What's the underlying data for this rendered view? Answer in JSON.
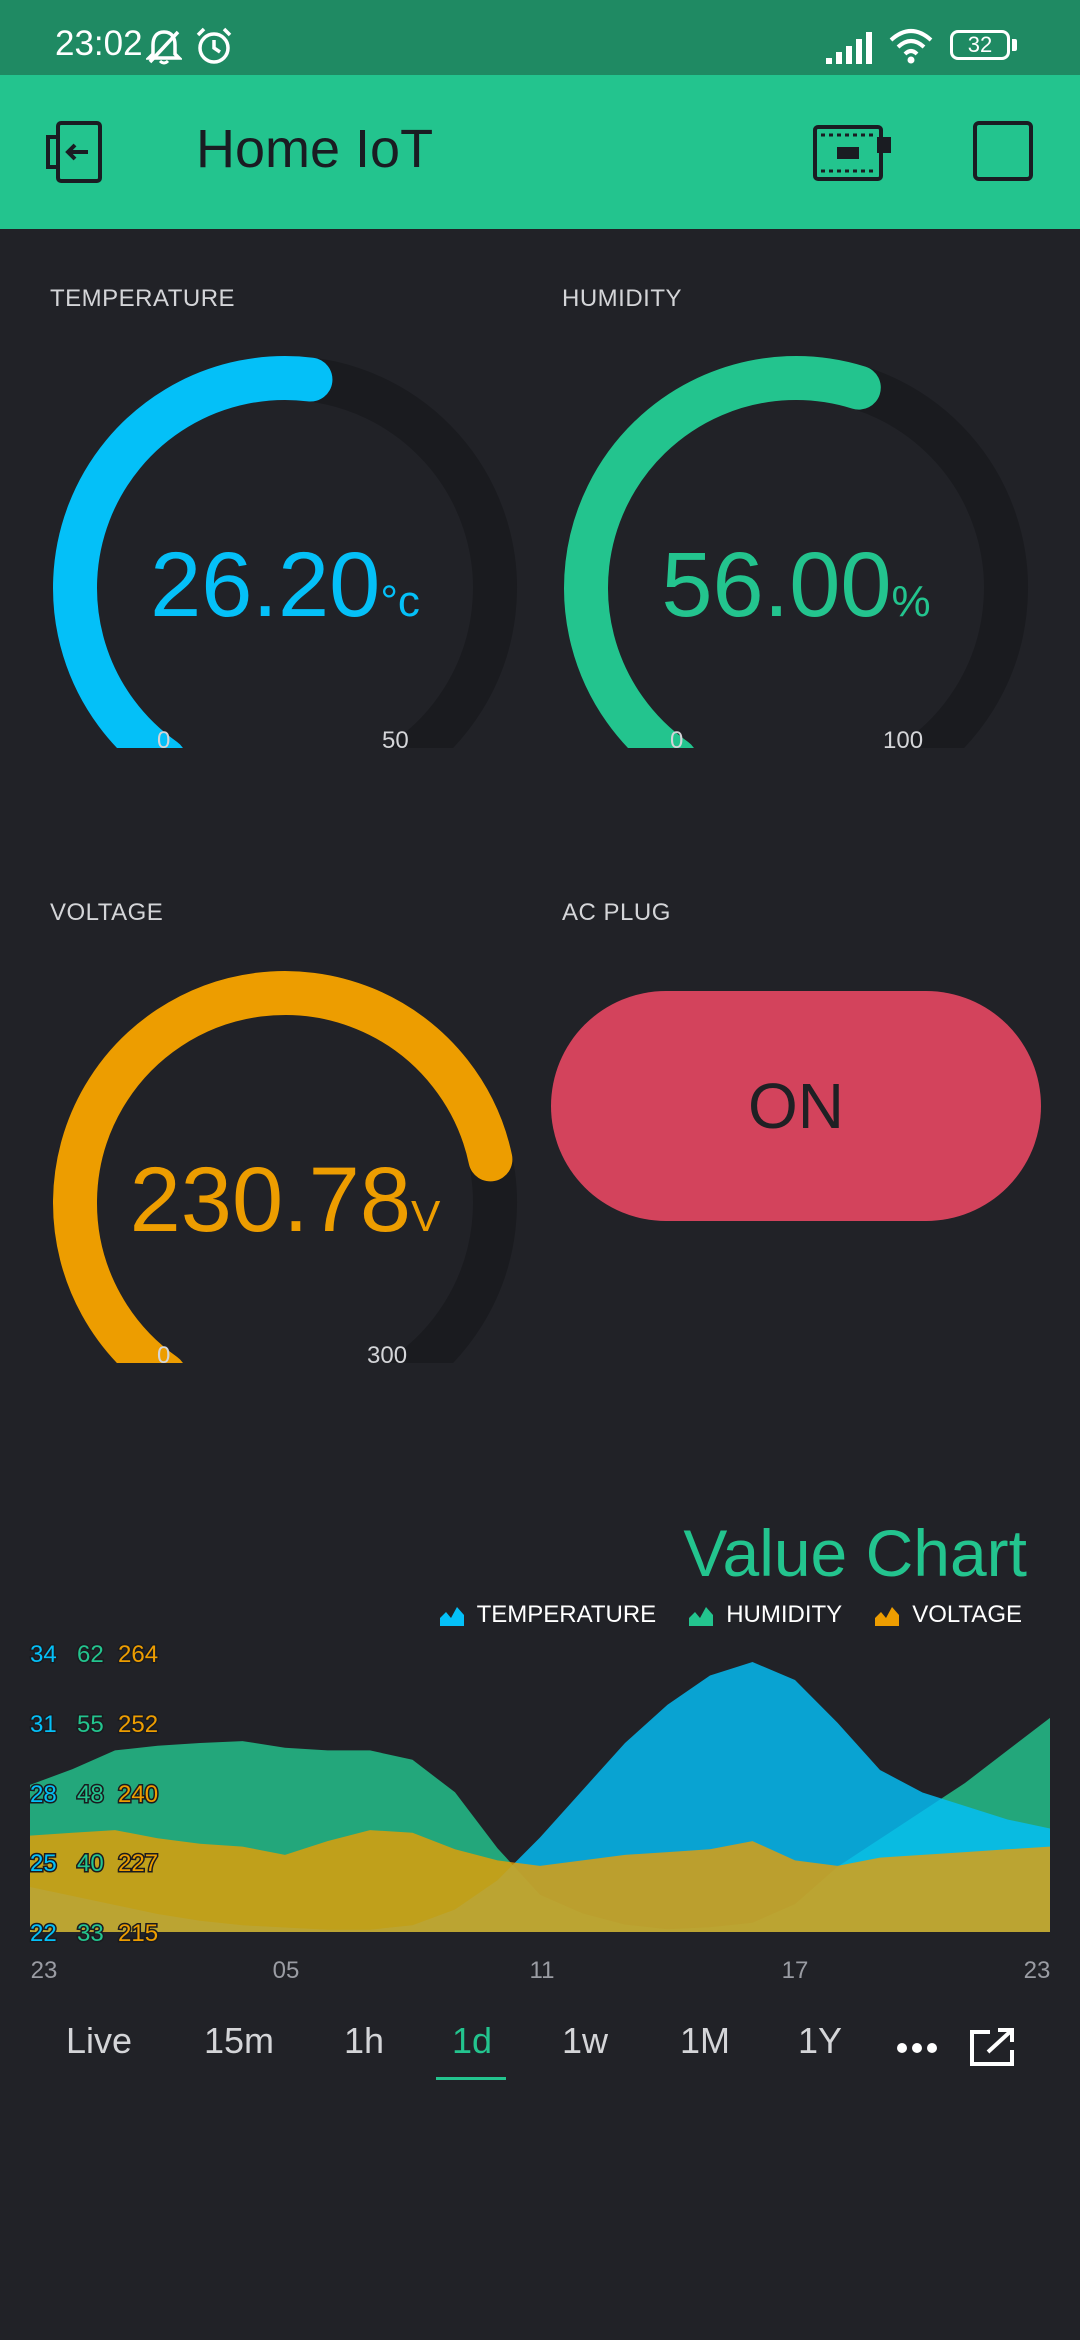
{
  "status_bar": {
    "time": "23:02",
    "battery": "32",
    "icons": [
      "bell-off-icon",
      "alarm-icon",
      "signal-icon",
      "wifi-icon",
      "battery-icon"
    ]
  },
  "app_bar": {
    "title": "Home IoT",
    "icons": [
      "back-icon",
      "device-icon",
      "stop-icon"
    ]
  },
  "colors": {
    "temperature": "#04c0f8",
    "humidity": "#23c48e",
    "voltage": "#ed9d00",
    "plug": "#d3435c",
    "accent": "#23c48e"
  },
  "gauges": {
    "temperature": {
      "label": "TEMPERATURE",
      "value": "26.20",
      "unit": "°c",
      "min": "0",
      "max": "50",
      "fraction": 0.524
    },
    "humidity": {
      "label": "HUMIDITY",
      "value": "56.00",
      "unit": "%",
      "min": "0",
      "max": "100",
      "fraction": 0.56
    },
    "voltage": {
      "label": "VOLTAGE",
      "value": "230.78",
      "unit": "V",
      "min": "0",
      "max": "300",
      "fraction": 0.769
    }
  },
  "plug": {
    "label": "AC PLUG",
    "state": "ON"
  },
  "chart": {
    "title": "Value Chart",
    "legend": [
      "TEMPERATURE",
      "HUMIDITY",
      "VOLTAGE"
    ],
    "y_ticks": {
      "temperature": [
        "34",
        "31",
        "28",
        "25",
        "22"
      ],
      "humidity": [
        "62",
        "55",
        "48",
        "40",
        "33"
      ],
      "voltage": [
        "264",
        "252",
        "240",
        "227",
        "215"
      ]
    },
    "x_ticks": [
      "23",
      "05",
      "11",
      "17",
      "23"
    ]
  },
  "chart_data": {
    "type": "area",
    "title": "Value Chart",
    "x": [
      "23",
      "00",
      "01",
      "02",
      "03",
      "04",
      "05",
      "06",
      "07",
      "08",
      "09",
      "10",
      "11",
      "12",
      "13",
      "14",
      "15",
      "16",
      "17",
      "18",
      "19",
      "20",
      "21",
      "22",
      "23"
    ],
    "series": [
      {
        "name": "TEMPERATURE",
        "values": [
          24.0,
          23.6,
          23.2,
          22.8,
          22.5,
          22.3,
          22.2,
          22.1,
          22.1,
          22.3,
          23.0,
          24.3,
          26.2,
          28.3,
          30.4,
          32.1,
          33.4,
          34.0,
          33.2,
          31.3,
          29.2,
          28.2,
          27.6,
          27.0,
          26.6
        ]
      },
      {
        "name": "HUMIDITY",
        "values": [
          48.8,
          50.5,
          52.5,
          53.0,
          53.3,
          53.5,
          52.8,
          52.5,
          52.5,
          51.5,
          48.0,
          42.0,
          37.0,
          35.0,
          33.8,
          33.3,
          33.5,
          34.0,
          36.0,
          40.0,
          43.0,
          46.0,
          49.0,
          52.5,
          56.0
        ]
      },
      {
        "name": "VOLTAGE",
        "values": [
          232.5,
          233.0,
          233.5,
          232.0,
          231.0,
          230.5,
          229.0,
          231.5,
          233.5,
          233.0,
          230.0,
          228.0,
          227.0,
          228.0,
          229.0,
          229.5,
          230.0,
          231.5,
          228.0,
          227.0,
          228.5,
          229.0,
          229.5,
          230.0,
          230.5
        ]
      }
    ],
    "ylim": {
      "temperature": [
        22,
        34
      ],
      "humidity": [
        33,
        62
      ],
      "voltage": [
        215,
        264
      ]
    }
  },
  "time_range": {
    "tabs": [
      "Live",
      "15m",
      "1h",
      "1d",
      "1w",
      "1M",
      "1Y"
    ],
    "active": "1d"
  }
}
